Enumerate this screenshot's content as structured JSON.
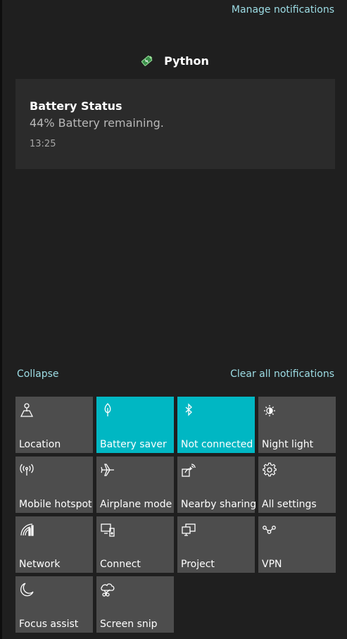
{
  "header": {
    "manage_link": "Manage notifications"
  },
  "notification_group": {
    "app_name": "Python",
    "app_icon": "battery-app-icon",
    "toast": {
      "title": "Battery Status",
      "body": "44% Battery remaining.",
      "time": "13:25"
    }
  },
  "footer_links": {
    "collapse": "Collapse",
    "clear_all": "Clear all notifications"
  },
  "colors": {
    "accent": "#00b7c3",
    "link": "#9ddde5",
    "tile_off": "#4d4d4d",
    "background": "#1f1f1f"
  },
  "quick_actions": [
    {
      "label": "Location",
      "icon": "location-icon",
      "active": false
    },
    {
      "label": "Battery saver",
      "icon": "battery-saver-icon",
      "active": true
    },
    {
      "label": "Not connected",
      "icon": "bluetooth-icon",
      "active": true
    },
    {
      "label": "Night light",
      "icon": "night-light-icon",
      "active": false
    },
    {
      "label": "Mobile hotspot",
      "icon": "hotspot-icon",
      "active": false
    },
    {
      "label": "Airplane mode",
      "icon": "airplane-icon",
      "active": false
    },
    {
      "label": "Nearby sharing",
      "icon": "nearby-sharing-icon",
      "active": false
    },
    {
      "label": "All settings",
      "icon": "gear-icon",
      "active": false
    },
    {
      "label": "Network",
      "icon": "network-icon",
      "active": false
    },
    {
      "label": "Connect",
      "icon": "connect-icon",
      "active": false
    },
    {
      "label": "Project",
      "icon": "project-icon",
      "active": false
    },
    {
      "label": "VPN",
      "icon": "vpn-icon",
      "active": false
    },
    {
      "label": "Focus assist",
      "icon": "moon-icon",
      "active": false
    },
    {
      "label": "Screen snip",
      "icon": "screen-snip-icon",
      "active": false
    }
  ]
}
